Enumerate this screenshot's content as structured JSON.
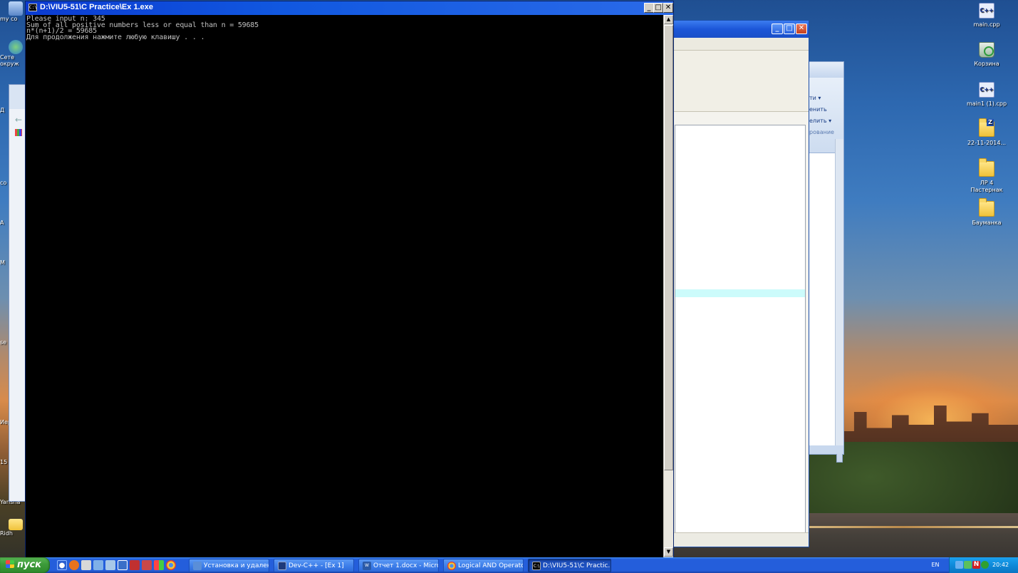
{
  "console": {
    "title": "D:\\VIU5-51\\C Practice\\Ex 1.exe",
    "icon_text": "C:\\",
    "lines": [
      "Please input n: 345",
      "Sum of all positive numbers less or equal than n = 59685",
      "n*(n+1)/2 = 59685",
      "Для продолжения нажмите любую клавишу . . ."
    ],
    "minimize_glyph": "_",
    "maximize_glyph": "□",
    "close_glyph": "✕"
  },
  "left_desktop_labels": [
    "my co",
    "Сете",
    "окруж",
    "Д",
    "co",
    "A",
    "M",
    "se",
    "Иер",
    "15",
    "Yarlsha",
    "Ridh"
  ],
  "right_desktop_icons": [
    {
      "label": "main.cpp",
      "icon": "cpp-file-icon"
    },
    {
      "label": "Корзина",
      "icon": "recycle-bin-icon"
    },
    {
      "label": "main1 (1).cpp",
      "icon": "cpp-file-icon"
    },
    {
      "label": "22-11-2014...",
      "icon": "zip-folder-icon"
    },
    {
      "label": "ЛР 4 Пастернак",
      "icon": "folder-icon"
    },
    {
      "label": "Бауманка",
      "icon": "folder-icon"
    }
  ],
  "office_ribbon": [
    "ти ▾",
    "енить",
    "елить ▾",
    "рование"
  ],
  "taskbar": {
    "start_label": "пуск",
    "buttons": [
      {
        "label": "Установка и удален...",
        "icon": "control-panel-icon",
        "active": false
      },
      {
        "label": "Dev-C++ - [Ex 1]",
        "icon": "devcpp-icon",
        "active": false
      },
      {
        "label": "Отчет 1.docx - Micro...",
        "icon": "word-icon",
        "active": false
      },
      {
        "label": "Logical AND Operator...",
        "icon": "chrome-icon",
        "active": false
      },
      {
        "label": "D:\\VIU5-51\\C Practic...",
        "icon": "console-icon",
        "active": true
      }
    ],
    "language": "EN",
    "clock": "20:42"
  },
  "colors": {
    "console_bg": "#000000",
    "console_text": "#c0c0c0",
    "xp_title_blue": "#0b3bd1",
    "start_green": "#3c9a3a",
    "taskbar_blue": "#245edb"
  }
}
